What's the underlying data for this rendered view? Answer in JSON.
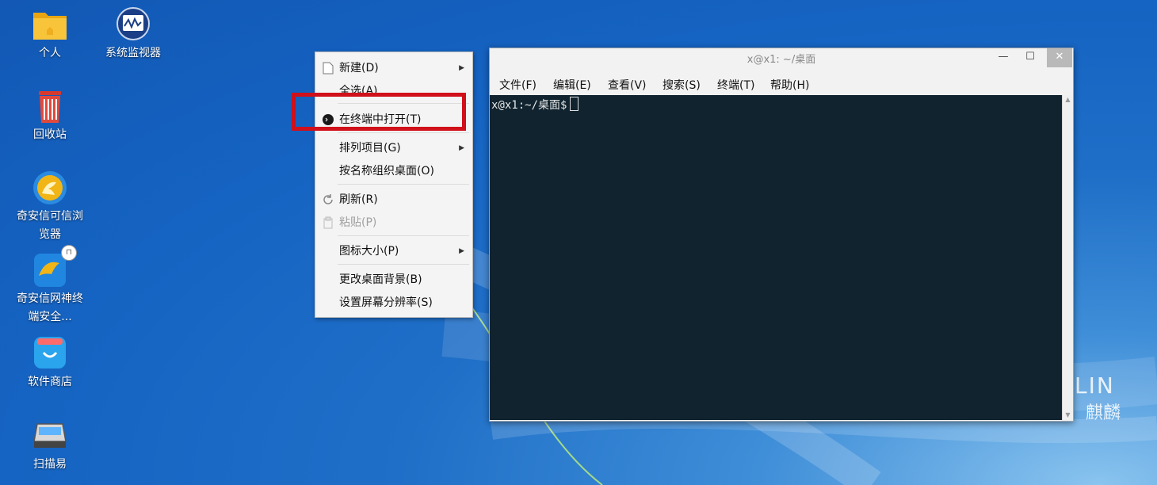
{
  "desktop": {
    "icons": [
      {
        "label": "个人"
      },
      {
        "label": "系统监视器"
      },
      {
        "label": "回收站"
      },
      {
        "label": "奇安信可信浏览器"
      },
      {
        "label": "奇安信网神终端安全..."
      },
      {
        "label": "软件商店"
      },
      {
        "label": "扫描易"
      }
    ],
    "brand_text": "LIN",
    "brand_sub": "麒麟"
  },
  "context_menu": {
    "items": [
      {
        "label": "新建(D)",
        "icon": "file-icon",
        "submenu": true
      },
      {
        "label": "全选(A)"
      },
      {
        "label": "在终端中打开(T)",
        "icon": "terminal-icon"
      },
      {
        "label": "排列项目(G)",
        "submenu": true
      },
      {
        "label": "按名称组织桌面(O)"
      },
      {
        "label": "刷新(R)",
        "icon": "refresh-icon"
      },
      {
        "label": "粘贴(P)",
        "icon": "paste-icon",
        "disabled": true
      },
      {
        "label": "图标大小(P)",
        "submenu": true
      },
      {
        "label": "更改桌面背景(B)"
      },
      {
        "label": "设置屏幕分辨率(S)"
      }
    ],
    "highlight_color": "#d0101a"
  },
  "terminal": {
    "title": "x@x1: ~/桌面",
    "menu": [
      "文件(F)",
      "编辑(E)",
      "查看(V)",
      "搜索(S)",
      "终端(T)",
      "帮助(H)"
    ],
    "prompt": "x@x1:~/桌面$",
    "background": "#10232f"
  }
}
